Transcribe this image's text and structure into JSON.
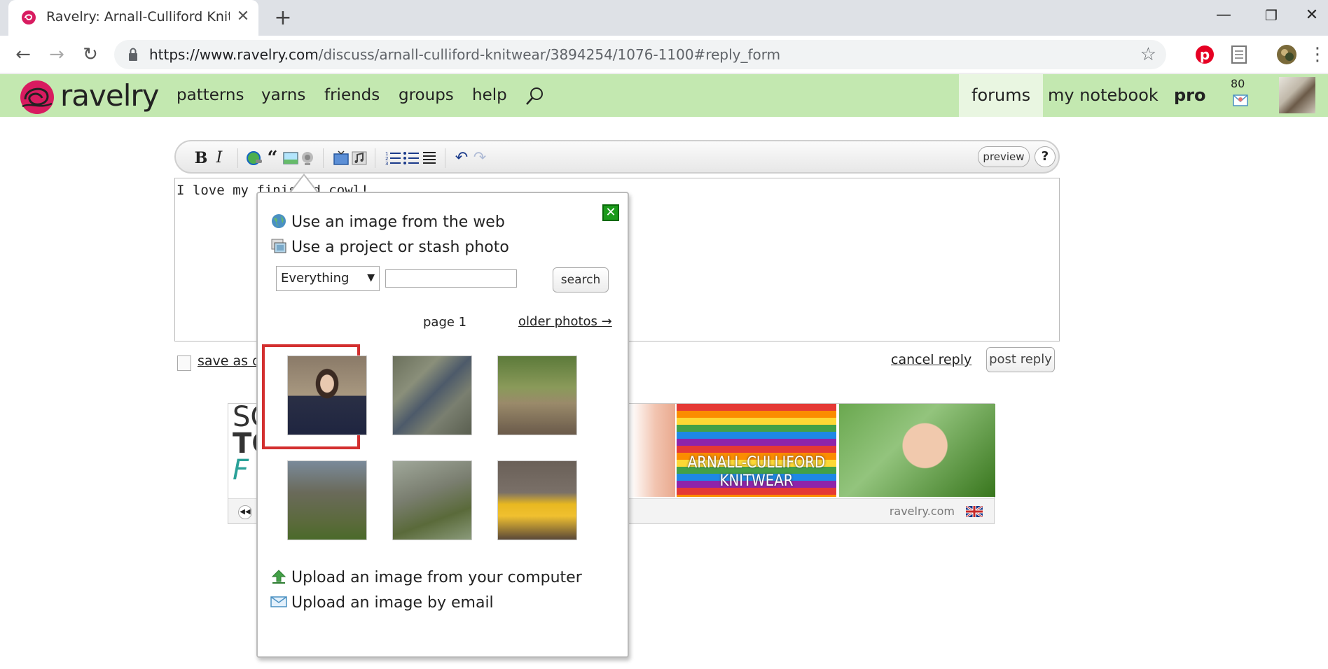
{
  "browser": {
    "tab_title": "Ravelry: Arnall-Culliford Knitwear",
    "tab_close": "✕",
    "new_tab": "+",
    "url_domain": "https://www.ravelry.com",
    "url_path": "/discuss/arnall-culliford-knitwear/3894254/1076-1100#reply_form",
    "minimize": "—",
    "restore": "❐",
    "close": "✕",
    "back": "←",
    "forward": "→",
    "reload": "↻",
    "star": "☆",
    "menu": "⋮"
  },
  "header": {
    "logo_text": "ravelry",
    "nav": [
      "patterns",
      "yarns",
      "friends",
      "groups",
      "help"
    ],
    "right_nav": [
      "forums",
      "my notebook",
      "pro"
    ],
    "active": "forums",
    "message_count": "80"
  },
  "editor": {
    "text": "I love my finished cowl!",
    "preview_label": "preview",
    "help_label": "?",
    "bold": "B",
    "italic": "I",
    "save_draft": "save as draft",
    "cancel_reply": "cancel reply",
    "post_reply": "post reply"
  },
  "ad": {
    "left_text_1": "SC",
    "left_text_2": "TO",
    "left_text_3": "F",
    "stripe_text_1": "ARNALL-CULLIFORD",
    "stripe_text_2": "KNITWEAR",
    "source": "ravelry.com"
  },
  "popup": {
    "close_label": "✕",
    "option_web": "Use an image from the web",
    "option_project": "Use a project or stash photo",
    "select_value": "Everything",
    "search_label": "search",
    "page_label": "page 1",
    "older_photos": "older photos →",
    "option_upload": "Upload an image from your computer",
    "option_email": "Upload an image by email",
    "thumbnails": [
      "woman-in-front-of-stone-wall",
      "pair-of-grey-socks",
      "socks-on-feet-outdoors",
      "boots-with-socks",
      "sock-on-foot-grass",
      "yellow-sneakers-with-socks"
    ]
  }
}
